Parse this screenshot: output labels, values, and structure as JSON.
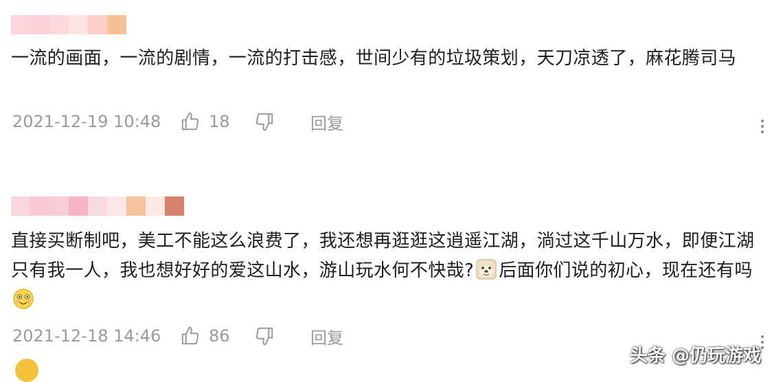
{
  "comments": [
    {
      "text": "一流的画面，一流的剧情，一流的打击感，世间少有的垃圾策划，天刀凉透了，麻花腾司马",
      "time": "2021-12-19 10:48",
      "likes": "18",
      "reply_label": "回复",
      "mosaic_colors": [
        "#fbd6dc",
        "#fbd2da",
        "#fad8de",
        "#fde3e4",
        "#fbd0c9",
        "#f7c197"
      ]
    },
    {
      "text_part1": "直接买断制吧，美工不能这么浪费了，我还想再逛逛这逍遥江湖，淌过这千山万水，即便江湖只有我一人，我也想好好的爱这山水，游山玩水何不快哉?",
      "text_part2": "后面你们说的初心，现在还有吗",
      "time": "2021-12-18 14:46",
      "likes": "86",
      "reply_label": "回复",
      "mosaic_colors": [
        "#f9d6dc",
        "#f8c8d3",
        "#f8cdd6",
        "#f6b5c4",
        "#f9d9e1",
        "#fde4e7",
        "#f7c39d",
        "#fde9e0",
        "#d6806e"
      ]
    }
  ],
  "icons": {
    "like": "thumbs-up-icon",
    "dislike": "thumbs-down-icon",
    "more": "more-vertical-icon"
  },
  "watermark": "头条 @仍玩游戏"
}
